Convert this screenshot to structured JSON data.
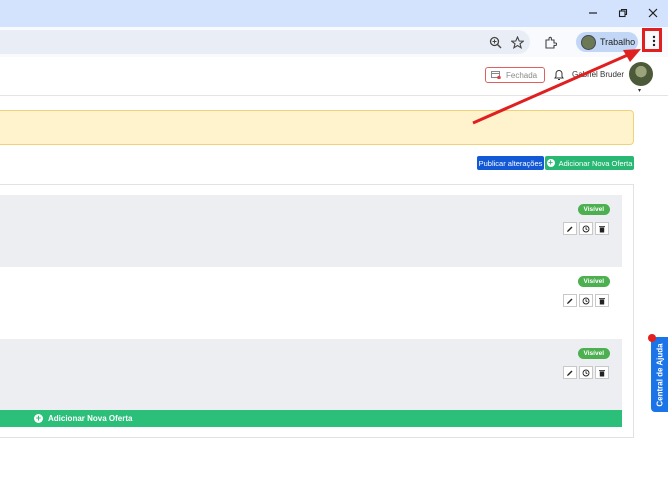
{
  "browser": {
    "profile_name": "Trabalho",
    "icons": [
      "minimize-icon",
      "restore-icon",
      "close-icon",
      "zoom-icon",
      "bookmark-star-icon",
      "extensions-icon",
      "kebab-menu-icon"
    ]
  },
  "header": {
    "status_label": "Fechada",
    "user_name": "Gabriel Bruder",
    "caret": "▾"
  },
  "actions": {
    "publish_label": "Publicar alterações",
    "add_offer_label": "Adicionar Nova Oferta"
  },
  "offers": [
    {
      "badge": "Visível"
    },
    {
      "badge": "Visível"
    },
    {
      "badge": "Visível"
    }
  ],
  "footer": {
    "add_offer_label": "Adicionar Nova Oferta"
  },
  "help": {
    "label": "Central de Ajuda"
  },
  "colors": {
    "annotation_red": "#e02020",
    "publish_blue": "#1359d6",
    "add_green": "#28b874",
    "badge_green": "#4caf50",
    "help_blue": "#1b74e8"
  }
}
